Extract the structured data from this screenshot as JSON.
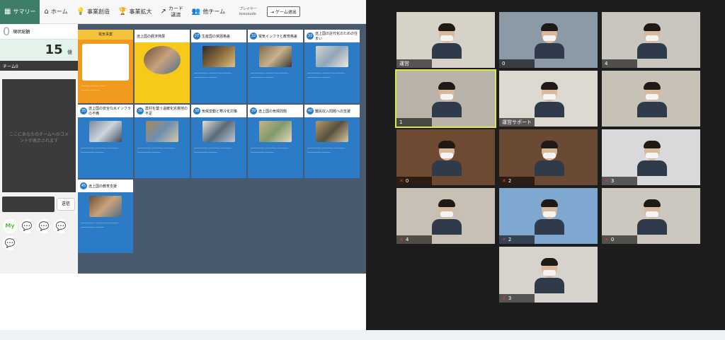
{
  "app": {
    "nav": {
      "summary": "サマリー",
      "home": "ホーム",
      "create": "事業創造",
      "expand": "事業拡大",
      "card_exchange_line1": "カード",
      "card_exchange_line2": "譲渡",
      "other_team": "他チーム",
      "player_label": "プレイヤー",
      "player_name": "kosuzudo",
      "logout": "ゲーム退出"
    },
    "left": {
      "score_title": "現状総額",
      "score_index": "0",
      "score_value": "15",
      "score_unit": "億",
      "team_label": "チーム0",
      "chat_placeholder": "ここにあなたのチームへのコメントが表示されます",
      "send_label": "送信",
      "stamp_my": "My"
    },
    "cards": [
      {
        "no": "27",
        "title": "生産国の貧困格差"
      },
      {
        "no": "32",
        "title": "電気インフラと教育格差"
      },
      {
        "no": "33",
        "title": "途上国の近代化のための住まい"
      },
      {
        "no": "35",
        "title": "途上国の安全な水インフラの不備"
      },
      {
        "no": "36",
        "title": "農村を襲う温暖化劣悪地の不足"
      },
      {
        "no": "38",
        "title": "気候変動と寒冷化対策"
      },
      {
        "no": "39",
        "title": "途上国の気候問題"
      },
      {
        "no": "40",
        "title": "難民収入問題への支援"
      },
      {
        "no": "45",
        "title": "途上国の教育支援"
      }
    ],
    "special_cards": {
      "orange_title": "電気事業",
      "yellow_title": "途上国の経済発展"
    }
  },
  "zoom": {
    "tiles": [
      {
        "name": "運営",
        "mic_muted": false
      },
      {
        "name": "0",
        "mic_muted": false
      },
      {
        "name": "4",
        "mic_muted": false
      },
      {
        "name": "1",
        "mic_muted": false
      },
      {
        "name": "運営サポート",
        "mic_muted": false
      },
      {
        "name": "",
        "mic_muted": false
      },
      {
        "name": "0",
        "mic_muted": true
      },
      {
        "name": "2",
        "mic_muted": true
      },
      {
        "name": "3",
        "mic_muted": true
      },
      {
        "name": "4",
        "mic_muted": true
      },
      {
        "name": "2",
        "mic_muted": true
      },
      {
        "name": "0",
        "mic_muted": true
      },
      {
        "name": "3",
        "mic_muted": true
      }
    ]
  }
}
